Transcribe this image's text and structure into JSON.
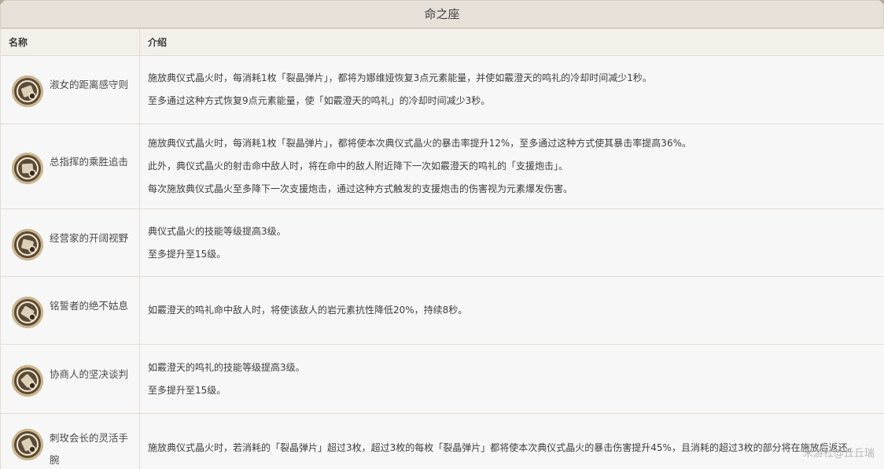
{
  "header": {
    "title": "命之座"
  },
  "table": {
    "columns": [
      "名称",
      "介绍"
    ],
    "rows": [
      {
        "name": "淑女的距离感守则",
        "icon": "constellation-1-icon",
        "desc": [
          "施放典仪式晶火时，每消耗1枚「裂晶弹片」，都将为娜维娅恢复3点元素能量，并使如霰澄天的鸣礼的冷却时间减少1秒。",
          "至多通过这种方式恢复9点元素能量，使「如霰澄天的鸣礼」的冷却时间减少3秒。"
        ]
      },
      {
        "name": "总指挥的乘胜追击",
        "icon": "constellation-2-icon",
        "desc": [
          "施放典仪式晶火时，每消耗1枚「裂晶弹片」，都将使本次典仪式晶火的暴击率提升12%，至多通过这种方式使其暴击率提高36%。",
          "此外，典仪式晶火的射击命中敌人时，将在命中的敌人附近降下一次如霰澄天的鸣礼的「支援炮击」。",
          "每次施放典仪式晶火至多降下一次支援炮击，通过这种方式触发的支援炮击的伤害视为元素爆发伤害。"
        ]
      },
      {
        "name": "经营家的开阔视野",
        "icon": "constellation-3-icon",
        "desc": [
          "典仪式晶火的技能等级提高3级。",
          "至多提升至15级。"
        ]
      },
      {
        "name": "铭誓者的绝不姑息",
        "icon": "constellation-4-icon",
        "desc": [
          "如霰澄天的鸣礼命中敌人时，将使该敌人的岩元素抗性降低20%，持续8秒。"
        ]
      },
      {
        "name": "协商人的坚决谈判",
        "icon": "constellation-5-icon",
        "desc": [
          "如霰澄天的鸣礼的技能等级提高3级。",
          "至多提升至15级。"
        ]
      },
      {
        "name": "刺玫会长的灵活手腕",
        "icon": "constellation-6-icon",
        "desc": [
          "施放典仪式晶火时，若消耗的「裂晶弹片」超过3枚，超过3枚的每枚「裂晶弹片」都将使本次典仪式晶火的暴击伤害提升45%，且消耗的超过3枚的部分将在施放后返还。"
        ]
      }
    ]
  },
  "watermark": "米游社@丘丘瑞"
}
